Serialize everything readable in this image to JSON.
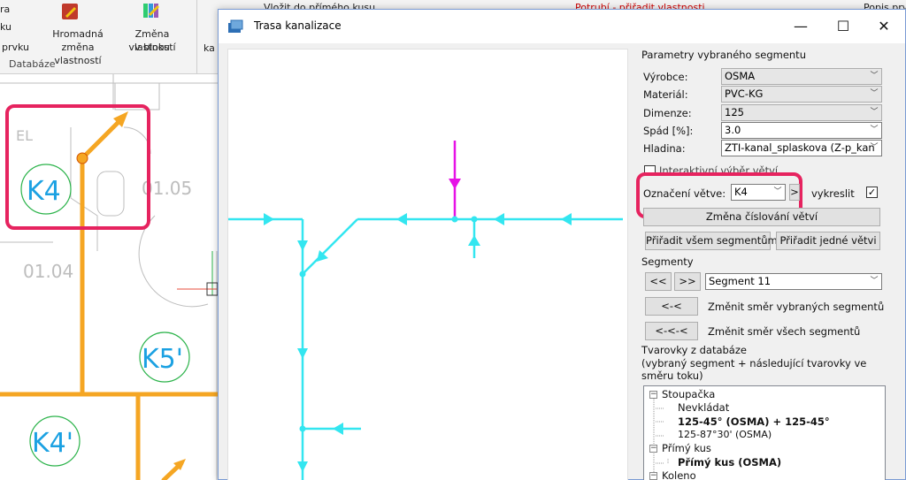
{
  "ribbon": {
    "left_labels": [
      "ra",
      "ku",
      "prvku"
    ],
    "btn_hromadna": [
      "Hromadná",
      "změna vlastností"
    ],
    "btn_zmena": [
      "Změna vlastností",
      "v bloku"
    ],
    "group_label": "Databáze",
    "cut_label": "ka",
    "small_vlozit": "Vložit do přímého kusu",
    "small_potrubi": "Potrubí - přiřadit vlastnosti",
    "small_popis": "Popis prv"
  },
  "cad": {
    "labels": [
      "K4",
      "K5'",
      "K4'"
    ],
    "room_texts": [
      "01.04",
      "01.05",
      "EL"
    ],
    "colors": {
      "pipe": "#f5a623",
      "label_text": "#1ba1e2",
      "label_circle": "#2bb34a",
      "wall": "#bdbdbd"
    }
  },
  "dialog": {
    "title": "Trasa kanalizace",
    "minimize": "—",
    "maximize": "☐",
    "close": "✕",
    "section_params": "Parametry vybraného segmentu",
    "fields": [
      {
        "label": "Výrobce:",
        "value": "OSMA"
      },
      {
        "label": "Materiál:",
        "value": "PVC-KG"
      },
      {
        "label": "Dimenze:",
        "value": "125"
      },
      {
        "label": "Spád [%]:",
        "value": "3.0"
      },
      {
        "label": "Hladina:",
        "value": "ZTI-kanal_splaskova (Z-p_kan"
      }
    ],
    "hidden_checkbox_label": "Interaktivní výběr větví",
    "branch_label": "Označení větve:",
    "branch_value": "K4",
    "branch_next": ">",
    "draw_label": "vykreslit",
    "draw_checked": "✓",
    "btn_renumber": "Změna číslování větví",
    "btn_assign_all": "Přiřadit všem segmentům",
    "btn_assign_one": "Přiřadit jedné větvi",
    "section_segments": "Segmenty",
    "btn_prev": "<<",
    "btn_next": ">>",
    "segment_value": "Segment 11",
    "btn_dir_selected": "<-<",
    "label_dir_selected": "Změnit směr vybraných segmentů",
    "btn_dir_all": "<-<-<",
    "label_dir_all": "Změnit směr všech segmentů",
    "section_fittings": "Tvarovky z databáze",
    "fittings_note": "(vybraný segment + následující tvarovky ve směru toku)",
    "tree": {
      "stoupacka": "Stoupačka",
      "nevkladat": "Nevkládat",
      "s1": "125-45° (OSMA) + 125-45°",
      "s2": "125-87°30' (OSMA)",
      "primy": "Přímý kus",
      "primy1": "Přímý kus (OSMA)",
      "koleno": "Koleno"
    },
    "colors": {
      "pipe": "#33e6f0",
      "selected": "#e612e6",
      "highlight": "#e6235f"
    }
  }
}
